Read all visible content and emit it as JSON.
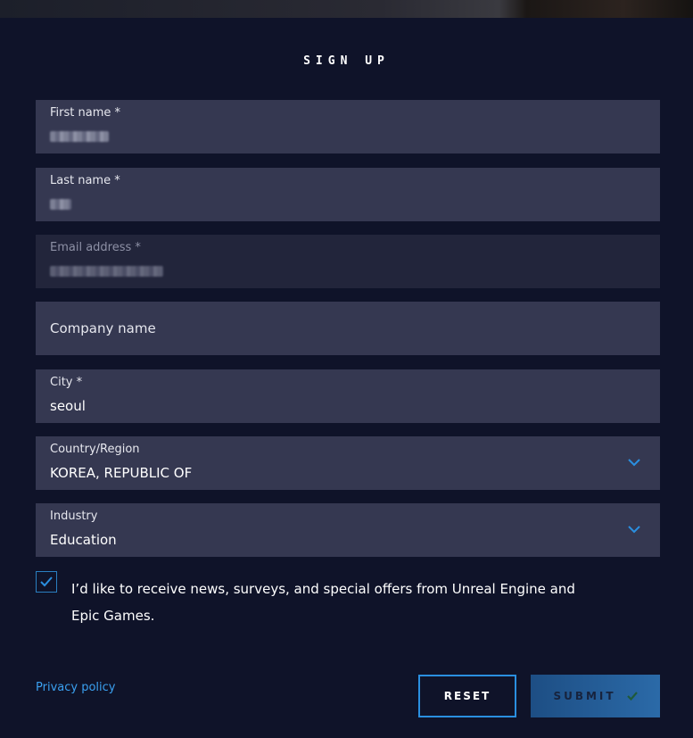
{
  "form": {
    "title": "SIGN UP",
    "fields": [
      {
        "label": "First name",
        "required_mark": "*"
      },
      {
        "label": "Last name",
        "required_mark": "*"
      },
      {
        "label": "Email address",
        "required_mark": "*"
      },
      {
        "placeholder": "Company name"
      },
      {
        "label": "City",
        "required_mark": "*",
        "value": "seoul"
      },
      {
        "label": "Country/Region",
        "value": "KOREA, REPUBLIC OF"
      },
      {
        "label": "Industry",
        "value": "Education"
      }
    ],
    "consent": {
      "checked": true,
      "text": "I’d like to receive news, surveys, and special offers from Unreal Engine and Epic Games."
    },
    "privacy_link": "Privacy policy",
    "reset_label": "RESET",
    "submit_label": "SUBMIT"
  },
  "colors": {
    "background": "#0f1329",
    "field": "#353851",
    "field_disabled": "#22253b",
    "accent": "#2a8fe0",
    "link": "#3aa0f0"
  },
  "icons": {
    "dropdown": "chevron-down-icon",
    "checkbox": "checkmark-icon",
    "submit": "checkmark-icon"
  }
}
